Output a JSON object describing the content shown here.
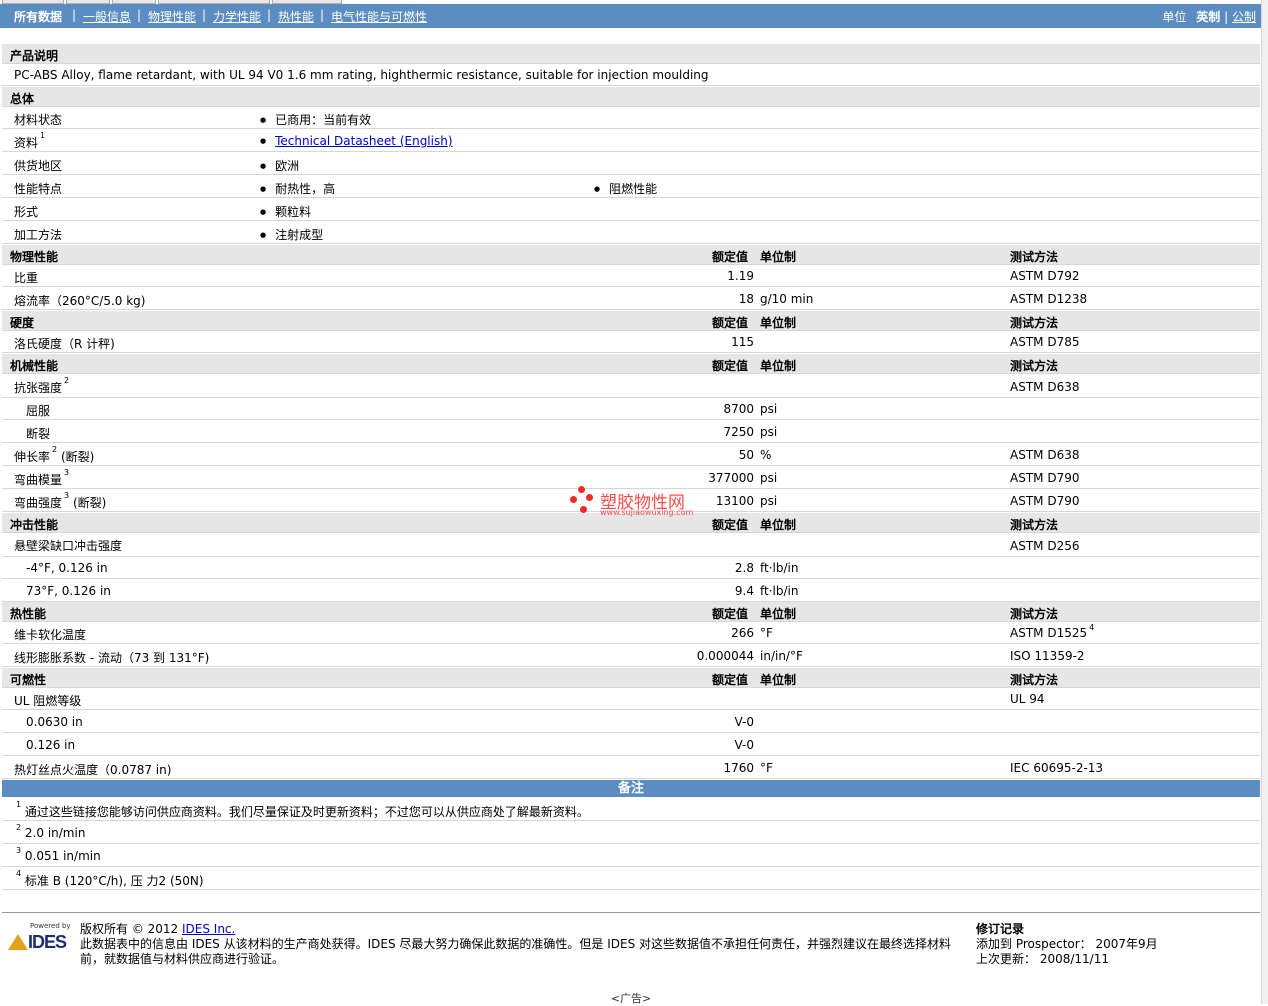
{
  "nav": {
    "items": [
      "所有数据",
      "一般信息",
      "物理性能",
      "力学性能",
      "热性能",
      "电气性能与可燃性"
    ],
    "unit_label": "单位",
    "unit_imperial": "英制",
    "unit_sep": "|",
    "unit_metric": "公制"
  },
  "desc": {
    "title": "产品说明",
    "text": "PC-ABS Alloy, flame retardant, with UL 94 V0 1.6 mm rating, highthermic resistance, suitable for injection moulding"
  },
  "general": {
    "title": "总体",
    "status_label": "材料状态",
    "status_value": "已商用：当前有效",
    "doc_label": "资料",
    "doc_sup": "1",
    "doc_value": "Technical Datasheet (English)",
    "region_label": "供货地区",
    "region_value": "欧洲",
    "feature_label": "性能特点",
    "feature_1": "耐热性，高",
    "feature_2": "阻燃性能",
    "form_label": "形式",
    "form_value": "颗粒料",
    "proc_label": "加工方法",
    "proc_value": "注射成型"
  },
  "headers": {
    "rated": "额定值",
    "unit": "单位制",
    "method": "测试方法"
  },
  "physical": {
    "title": "物理性能",
    "rows": [
      {
        "label": "比重",
        "value": "1.19",
        "unit": "",
        "method": "ASTM D792"
      },
      {
        "label": "熔流率（260°C/5.0 kg)",
        "value": "18",
        "unit": "g/10 min",
        "method": "ASTM D1238"
      }
    ]
  },
  "hardness": {
    "title": "硬度",
    "rows": [
      {
        "label": "洛氏硬度（R 计秤)",
        "value": "115",
        "unit": "",
        "method": "ASTM D785"
      }
    ]
  },
  "mechanical": {
    "title": "机械性能",
    "tensile_label": "抗张强度",
    "tensile_sup": "2",
    "tensile_method": "ASTM D638",
    "yield_label": "屈服",
    "yield_value": "8700",
    "yield_unit": "psi",
    "break_label": "断裂",
    "break_value": "7250",
    "break_unit": "psi",
    "elong_label": "伸长率",
    "elong_sup": "2",
    "elong_suffix": "(断裂)",
    "elong_value": "50",
    "elong_unit": "%",
    "elong_method": "ASTM D638",
    "flexmod_label": "弯曲模量",
    "flexmod_sup": "3",
    "flexmod_value": "377000",
    "flexmod_unit": "psi",
    "flexmod_method": "ASTM D790",
    "flexstr_label": "弯曲强度",
    "flexstr_sup": "3",
    "flexstr_suffix": "(断裂)",
    "flexstr_value": "13100",
    "flexstr_unit": "psi",
    "flexstr_method": "ASTM D790"
  },
  "impact": {
    "title": "冲击性能",
    "izod_label": "悬壁梁缺口冲击强度",
    "izod_method": "ASTM D256",
    "r1_label": "-4°F, 0.126 in",
    "r1_value": "2.8",
    "r1_unit": "ft·lb/in",
    "r2_label": "73°F, 0.126 in",
    "r2_value": "9.4",
    "r2_unit": "ft·lb/in"
  },
  "thermal": {
    "title": "热性能",
    "vicat_label": "维卡软化温度",
    "vicat_value": "266",
    "vicat_unit": "°F",
    "vicat_method": "ASTM D1525",
    "vicat_sup": "4",
    "clte_label": "线形膨胀系数 - 流动（73 到  131°F)",
    "clte_value": "0.000044",
    "clte_unit": "in/in/°F",
    "clte_method": "ISO 11359-2"
  },
  "flammability": {
    "title": "可燃性",
    "ul_label": "UL 阻燃等级",
    "ul_method": "UL 94",
    "r1_label": "0.0630 in",
    "r1_value": "V-0",
    "r2_label": "0.126 in",
    "r2_value": "V-0",
    "gwit_label": "热灯丝点火温度（0.0787 in)",
    "gwit_value": "1760",
    "gwit_unit": "°F",
    "gwit_method": "IEC 60695-2-13"
  },
  "notes": {
    "title": "备注",
    "items": [
      {
        "sup": "1",
        "text": "通过这些链接您能够访问供应商资料。我们尽量保证及时更新资料；不过您可以从供应商处了解最新资料。"
      },
      {
        "sup": "2",
        "text": "2.0 in/min"
      },
      {
        "sup": "3",
        "text": "0.051 in/min"
      },
      {
        "sup": "4",
        "text": "标准 B (120°C/h), 压 力2 (50N)"
      }
    ]
  },
  "footer": {
    "powered": "Powered by",
    "logo_text": "IDES",
    "copy_prefix": "版权所有 © 2012 ",
    "copy_link": "IDES Inc.",
    "disclaimer": "此数据表中的信息由 IDES 从该材料的生产商处获得。IDES 尽最大努力确保此数据的准确性。但是 IDES 对这些数据值不承担任何责任，并强烈建议在最终选择材料前，就数据值与材料供应商进行验证。",
    "rev_title": "修订记录",
    "rev_added": "添加到 Prospector： 2007年9月",
    "rev_updated": "上次更新： 2008/11/11"
  },
  "watermark": {
    "cn": "塑胶物性网",
    "url": "www.sujiaowuxing.com"
  },
  "ad": "<广告>"
}
